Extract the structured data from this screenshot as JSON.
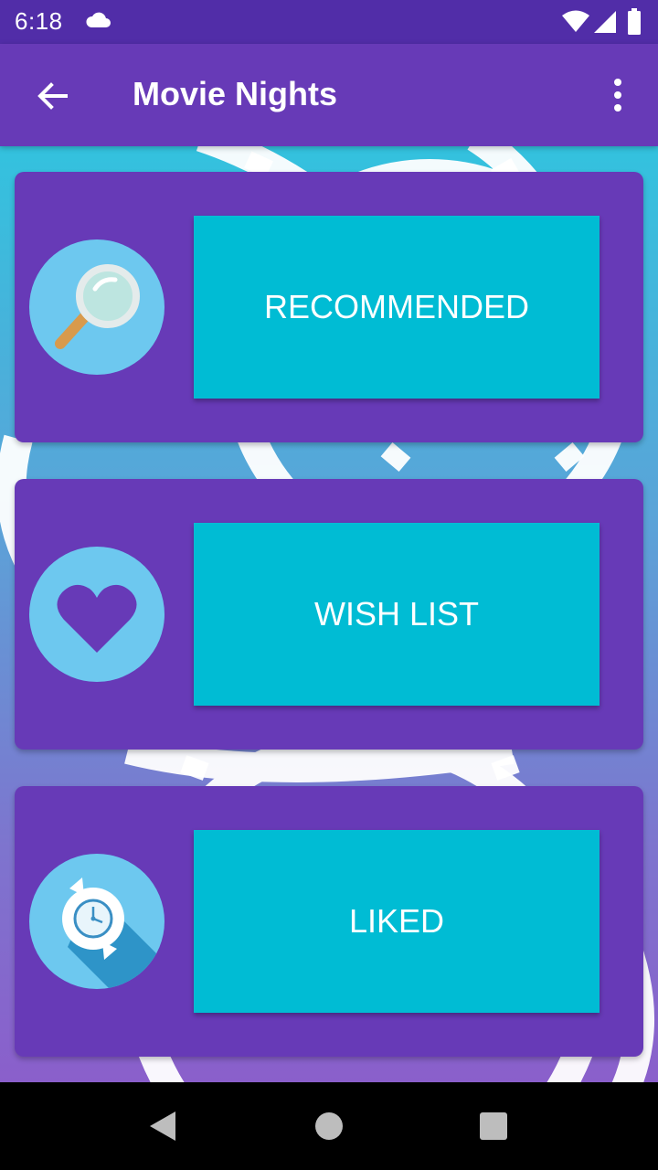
{
  "status_bar": {
    "time": "6:18",
    "icons": [
      "cloud-icon",
      "wifi-icon",
      "signal-icon",
      "battery-icon"
    ]
  },
  "app_bar": {
    "title": "Movie Nights",
    "back_icon": "arrow-back-icon",
    "menu_icon": "more-vert-icon"
  },
  "cards": [
    {
      "label": "RECOMMENDED",
      "icon": "magnifier-icon"
    },
    {
      "label": "WISH LIST",
      "icon": "heart-icon"
    },
    {
      "label": "LIKED",
      "icon": "clock-refresh-icon"
    }
  ],
  "nav_bar": {
    "icons": [
      "back-triangle-icon",
      "home-circle-icon",
      "recents-square-icon"
    ]
  },
  "colors": {
    "status_bar": "#512DA8",
    "primary": "#673AB7",
    "accent": "#00BCD4",
    "icon_circle": "#6DC8EF"
  }
}
